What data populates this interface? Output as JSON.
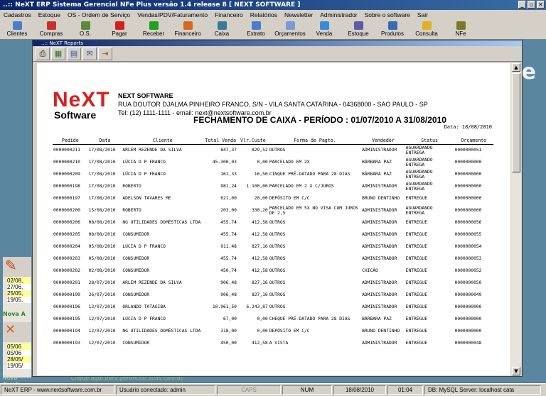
{
  "window": {
    "title": "..:: NeXT ERP Sistema Gerencial NFe Plus versão 1.4 release 8  [ NEXT SOFTWARE ]",
    "controls": [
      "_",
      "▫",
      "✕"
    ]
  },
  "menu": [
    "Cadastros",
    "Estoque",
    "OS - Ordem de Serviço",
    "Vendas/PDV/Faturamento",
    "Financeiro",
    "Relatórios",
    "Newsletter",
    "Administrador",
    "Sobre o software",
    "Sair"
  ],
  "toolbar": [
    {
      "label": "Clientes",
      "icon": "clients-icon",
      "color": "#4a7ec8"
    },
    {
      "label": "Compras",
      "icon": "cart-icon",
      "color": "#c83030"
    },
    {
      "label": "O.S.",
      "icon": "service-icon",
      "color": "#5a8a3a"
    },
    {
      "label": "Pagar",
      "icon": "minus-icon",
      "color": "#d02020"
    },
    {
      "label": "Receber",
      "icon": "plus-icon",
      "color": "#20a020"
    },
    {
      "label": "Financeiro",
      "icon": "finance-icon",
      "color": "#d06a20"
    },
    {
      "label": "Caixa",
      "icon": "cashbox-icon",
      "color": "#3a7a9a"
    },
    {
      "label": "Extrato",
      "icon": "statement-icon",
      "color": "#4a7ec8"
    },
    {
      "label": "Orçamentos",
      "icon": "budget-icon",
      "color": "#7a9ad8"
    },
    {
      "label": "Venda",
      "icon": "sale-icon",
      "color": "#3a8ad8"
    },
    {
      "label": "Estoque",
      "icon": "stock-icon",
      "color": "#5a5aa8"
    },
    {
      "label": "Produtos",
      "icon": "products-icon",
      "color": "#3a6ab8"
    },
    {
      "label": "Consulta",
      "icon": "query-icon",
      "color": "#e0b020"
    },
    {
      "label": "NFe",
      "icon": "nfe-icon",
      "color": "#7a7a2a"
    }
  ],
  "background": {
    "logo": "e"
  },
  "side_panel": {
    "dates_1": [
      "02/08,",
      "27/06,",
      "25/05,",
      "19/05,"
    ],
    "label_task": "Nova A",
    "dates_2": [
      "05/06",
      "05/06",
      "28/05/",
      "19/05/"
    ],
    "nova_tarefa": "Nova Tarefa",
    "task_msg": "Clique aqui para gerenciar suas tarefas"
  },
  "report_window": {
    "title": "..:: NeXT Reports",
    "tools": [
      "print-icon",
      "excel-icon",
      "export-icon",
      "email-icon",
      "exit-icon"
    ]
  },
  "report": {
    "logo_top": "NeXT",
    "logo_bottom": "Software",
    "company_name": "NEXT SOFTWARE",
    "company_address": "RUA DOUTOR DJALMA PINHEIRO FRANCO, S/N - VILA SANTA CATARINA - 04368000 - SAO PAULO - SP",
    "company_contact": "Tel: (12) 1111-1111 - email: next@nextsoftware.com.br",
    "title": "FECHAMENTO DE CAIXA - PERÍODO : 01/07/2010 A 31/08/2010",
    "date_label": "Data: 18/08/2010",
    "columns": [
      "Pedido",
      "Data",
      "Cliente",
      "Total Venda",
      "Vlr.Custo",
      "Forma de Pagto.",
      "Vendedor",
      "Status",
      "Orçamento"
    ],
    "rows": [
      [
        "0000000211",
        "17/08/2010",
        "ARLEM REZENDE DA SILVA",
        "847,37",
        "829,52",
        "OUTROS",
        "ADMINISTRADOR",
        "AGUARDANDO ENTREGA",
        "0000000051"
      ],
      [
        "0000000210",
        "17/08/2010",
        "LÚCIA D P FRANCO",
        "45.300,03",
        "0,00",
        "PARCELADO EM 2X",
        "BÁRBARA PAZ",
        "AGUARDANDO ENTREGA",
        "0000000000"
      ],
      [
        "0000000209",
        "17/08/2010",
        "LÚCIA D P FRANCO",
        "161,33",
        "16,50",
        "CINQUE PRÉ-DATADO PARA 28 DIAS",
        "BÁRBARA PAZ",
        "AGUARDANDO ENTREGA",
        "0000000000"
      ],
      [
        "0000000198",
        "17/08/2010",
        "ROBERTO",
        "981,24",
        "1.100,00",
        "PARCELADO EM 2 X C/JUROS",
        "ADMINISTRADOR",
        "AGUARDANDO ENTREGA",
        "0000000000"
      ],
      [
        "0000000197",
        "17/08/2010",
        "ADELSON TAVARES ME",
        "621,00",
        "20,00",
        "DEPÓSITO EM C/C",
        "BRUNO DENTINHO",
        "ENTREGUE",
        "0000000000"
      ],
      [
        "0000000200",
        "15/08/2010",
        "ROBERTO",
        "203,00",
        "330,20",
        "PARCELADO EM 5X NO VISA COM JUROS DE 2,5",
        "ADMINISTRADOR",
        "AGUARDANDO ENTREGA",
        "0000000000"
      ],
      [
        "0000000206",
        "08/08/2010",
        "NG UTILIDADES DOMÉSTICAS LTDA",
        "455,74",
        "412,58",
        "OUTROS",
        "ADMINISTRADOR",
        "ENTREGUE",
        "0000000056"
      ],
      [
        "0000000205",
        "08/08/2010",
        "CONSUMIDOR",
        "455,74",
        "412,58",
        "OUTROS",
        "ADMINISTRADOR",
        "ENTREGUE",
        "0000000055"
      ],
      [
        "0000000204",
        "05/08/2010",
        "LÚCIA D P FRANCO",
        "911,48",
        "827,16",
        "OUTROS",
        "ADMINISTRADOR",
        "ENTREGUE",
        "0000000054"
      ],
      [
        "0000000203",
        "05/08/2010",
        "CONSUMIDOR",
        "455,74",
        "412,58",
        "OUTROS",
        "ADMINISTRADOR",
        "ENTREGUE",
        "0000000053"
      ],
      [
        "0000000202",
        "02/08/2010",
        "CONSUMIDOR",
        "450,74",
        "412,58",
        "OUTROS",
        "CHICÃO",
        "ENTREGUE",
        "0000000052"
      ],
      [
        "0000000201",
        "28/07/2010",
        "ARLEM REZENDE DA SILVA",
        "906,48",
        "827,16",
        "OUTROS",
        "ADMINISTRADOR",
        "ENTREGUE",
        "0000000050"
      ],
      [
        "0000000199",
        "26/07/2010",
        "CONSUMIDOR",
        "906,48",
        "827,16",
        "OUTROS",
        "ADMINISTRADOR",
        "ENTREGUE",
        "0000000049"
      ],
      [
        "0000000196",
        "13/07/2010",
        "ORLANDO TATAGIBA",
        "10.961,50",
        "6.243,87",
        "OUTROS",
        "ADMINISTRADOR",
        "ENTREGUE",
        "0000000000"
      ],
      [
        "0000000195",
        "12/07/2010",
        "LÚCIA D P FRANCO",
        "67,00",
        "0,00",
        "CHEQUE PRÉ-DATADO PARA 28 DIAS",
        "BÁRBARA PAZ",
        "ENTREGUE",
        "0000000000"
      ],
      [
        "0000000194",
        "12/07/2010",
        "NG UTILIDADES DOMÉSTICAS LTDA",
        "318,00",
        "0,00",
        "DEPÓSITO EM C/C",
        "BRUNO DENTINHO",
        "ENTREGUE",
        "0000000000"
      ],
      [
        "0000000193",
        "12/07/2010",
        "CONSUMIDOR",
        "450,00",
        "412,58",
        "A VISTA",
        "ADMINISTRADOR",
        "ENTREGUE",
        "0000000048"
      ]
    ]
  },
  "statusbar": [
    "NeXT ERP - www.nextsoftware.com.br",
    "Usuário conectado: admin",
    "CAPS",
    "NUM",
    "18/08/2010",
    "01:04",
    "DB: MySQL Server: localhost cata"
  ]
}
